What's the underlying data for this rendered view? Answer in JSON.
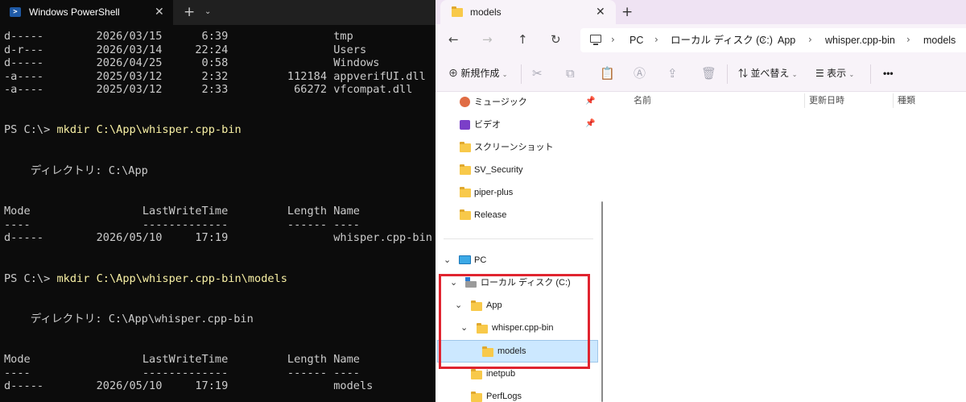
{
  "terminal": {
    "tab_title": "Windows PowerShell",
    "tab_close": "✕",
    "new_tab": "+",
    "dropdown": "⌄",
    "prompt": "PS C:\\> ",
    "lines": [
      {
        "text": "d-----        2026/03/15      6:39                tmp"
      },
      {
        "text": "d-r---        2026/03/14     22:24                Users"
      },
      {
        "text": "d-----        2026/04/25      0:58                Windows"
      },
      {
        "text": "-a----        2025/03/12      2:32         112184 appverifUI.dll"
      },
      {
        "text": "-a----        2025/03/12      2:33          66272 vfcompat.dll"
      },
      {
        "cmd": "mkdir C:\\App\\whisper.cpp-bin"
      },
      {
        "text": "    ディレクトリ: C:\\App"
      },
      {
        "text": "Mode                 LastWriteTime         Length Name"
      },
      {
        "text": "----                 -------------         ------ ----"
      },
      {
        "text": "d-----        2026/05/10     17:19                whisper.cpp-bin"
      },
      {
        "cmd": "mkdir C:\\App\\whisper.cpp-bin\\models"
      },
      {
        "text": "    ディレクトリ: C:\\App\\whisper.cpp-bin"
      },
      {
        "text": "Mode                 LastWriteTime         Length Name"
      },
      {
        "text": "----                 -------------         ------ ----"
      },
      {
        "text": "d-----        2026/05/10     17:19                models"
      }
    ]
  },
  "explorer": {
    "tab_title": "models",
    "tab_close": "✕",
    "new_tab": "+",
    "nav": {
      "back": "←",
      "forward": "→",
      "up": "↑",
      "refresh": "↻"
    },
    "breadcrumbs": [
      "PC",
      "ローカル ディスク (C:)",
      "App",
      "whisper.cpp-bin",
      "models"
    ],
    "crumb_sep": "›",
    "toolbar": {
      "new_label": "新規作成",
      "sort_label": "並べ替え",
      "view_label": "表示",
      "more": "•••",
      "chevron": "⌄",
      "cut": "✂",
      "copy": "⧉",
      "paste": "📋",
      "rename": "Ⓐ",
      "share": "⇪",
      "delete": "🗑",
      "new_icon": "⊕",
      "sort_icon": "⇅",
      "view_icon": "☰"
    },
    "pin": "📌",
    "expanded": "⌄",
    "quick_access": [
      "ミュージック",
      "ビデオ",
      "スクリーンショット",
      "SV_Security",
      "piper-plus",
      "Release"
    ],
    "tree": {
      "pc": "PC",
      "drive": "ローカル ディスク (C:)",
      "app": "App",
      "whisper": "whisper.cpp-bin",
      "models": "models",
      "inetpub": "inetpub",
      "perflogs": "PerfLogs"
    },
    "columns": {
      "name": "名前",
      "date": "更新日時",
      "type": "種類"
    },
    "colors": {
      "highlight": "#e0242f",
      "selected": "#cce8ff",
      "folder": "#f8c94a"
    }
  }
}
